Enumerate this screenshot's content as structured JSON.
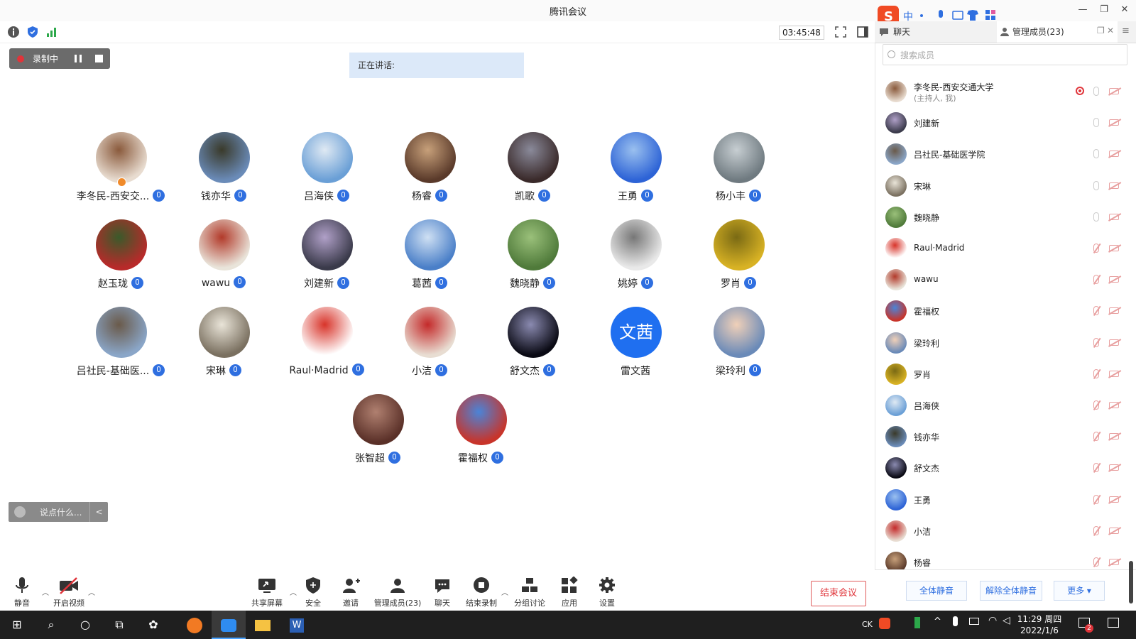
{
  "window": {
    "title": "腾讯会议"
  },
  "timer": "03:45:48",
  "recording": {
    "label": "录制中"
  },
  "speaking": {
    "label": "正在讲话:"
  },
  "participants": [
    {
      "name": "李冬民-西安交...",
      "avatar": "photo-woman",
      "host": true
    },
    {
      "name": "钱亦华",
      "avatar": "photo-campus"
    },
    {
      "name": "吕海侠",
      "avatar": "photo-sky"
    },
    {
      "name": "杨睿",
      "avatar": "photo-girl"
    },
    {
      "name": "凯歌",
      "avatar": "photo-fox"
    },
    {
      "name": "王勇",
      "avatar": "photo-tree"
    },
    {
      "name": "杨小丰",
      "avatar": "photo-storm"
    },
    {
      "name": "赵玉珑",
      "avatar": "photo-flowers"
    },
    {
      "name": "wawu",
      "avatar": "photo-portrait"
    },
    {
      "name": "刘建新",
      "avatar": "photo-man"
    },
    {
      "name": "葛茜",
      "avatar": "photo-lake"
    },
    {
      "name": "魏晓静",
      "avatar": "photo-path"
    },
    {
      "name": "姚婷",
      "avatar": "photo-sketch"
    },
    {
      "name": "罗肖",
      "avatar": "photo-ginkgo"
    },
    {
      "name": "吕社民-基础医...",
      "avatar": "photo-hills"
    },
    {
      "name": "宋琳",
      "avatar": "photo-cat"
    },
    {
      "name": "Raul·Madrid",
      "avatar": "photo-emblem"
    },
    {
      "name": "小洁",
      "avatar": "photo-rose"
    },
    {
      "name": "舒文杰",
      "avatar": "photo-galaxy"
    },
    {
      "name": "雷文茜",
      "avatar": "initials",
      "initials": "文茜"
    },
    {
      "name": "梁玲利",
      "avatar": "photo-child"
    },
    {
      "name": "张智超",
      "avatar": "photo-statue"
    },
    {
      "name": "霍福权",
      "avatar": "photo-building"
    }
  ],
  "chat_input": {
    "placeholder": "说点什么..."
  },
  "toolbar": {
    "mute": "静音",
    "video": "开启视频",
    "share": "共享屏幕",
    "security": "安全",
    "invite": "邀请",
    "members": "管理成员(23)",
    "chat": "聊天",
    "end_record": "结束录制",
    "breakout": "分组讨论",
    "apps": "应用",
    "settings": "设置",
    "end_meeting": "结束会议"
  },
  "panel": {
    "tab_chat": "聊天",
    "tab_members": "管理成员(23)",
    "search_placeholder": "搜索成员",
    "members": [
      {
        "name": "李冬民-西安交通大学",
        "sub": "(主持人, 我)",
        "recording": true,
        "muted": false
      },
      {
        "name": "刘建新",
        "muted": false
      },
      {
        "name": "吕社民-基础医学院",
        "muted": false
      },
      {
        "name": "宋琳",
        "muted": false
      },
      {
        "name": "魏晓静",
        "muted": false
      },
      {
        "name": "Raul·Madrid",
        "muted": true
      },
      {
        "name": "wawu",
        "muted": true
      },
      {
        "name": "霍福权",
        "muted": true
      },
      {
        "name": "梁玲利",
        "muted": true
      },
      {
        "name": "罗肖",
        "muted": true
      },
      {
        "name": "吕海侠",
        "muted": true
      },
      {
        "name": "钱亦华",
        "muted": true
      },
      {
        "name": "舒文杰",
        "muted": true
      },
      {
        "name": "王勇",
        "muted": true
      },
      {
        "name": "小洁",
        "muted": true
      },
      {
        "name": "杨睿",
        "muted": true
      }
    ],
    "mute_all": "全体静音",
    "unmute_all": "解除全体静音",
    "more": "更多 ▾"
  },
  "taskbar": {
    "ime": "CK",
    "time": "11:29 周四",
    "date": "2022/1/6",
    "notif_count": "2"
  },
  "colors": {
    "accent": "#2f6fe0",
    "danger": "#e0343a"
  }
}
